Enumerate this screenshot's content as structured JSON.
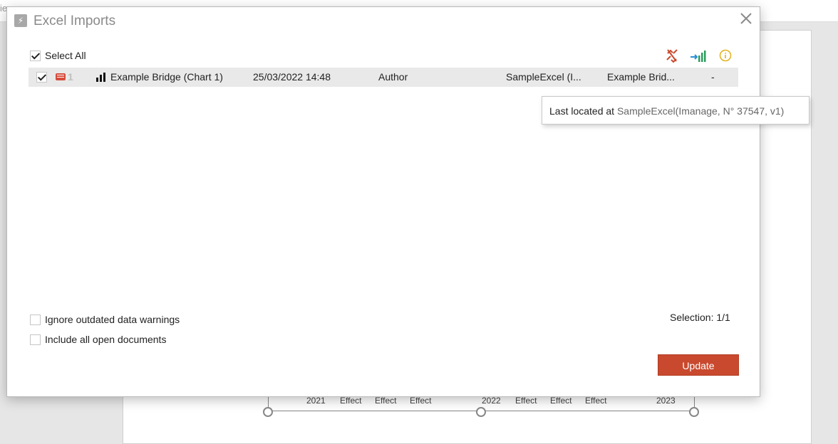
{
  "dialog": {
    "title": "Excel Imports",
    "select_all_label": "Select All",
    "select_all_checked": true,
    "toolbar_icons": [
      "broken-link-icon",
      "update-data-icon",
      "info-icon"
    ],
    "rows": [
      {
        "checked": true,
        "slide_number": "1",
        "name": "Example Bridge (Chart 1)",
        "date": "25/03/2022 14:48",
        "author": "Author",
        "source": "SampleExcel (I...",
        "sheet": "Example Brid...",
        "extra": "-"
      }
    ],
    "tooltip": {
      "prefix": "Last located at ",
      "location": "SampleExcel(Imanage, N° 37547, v1)"
    },
    "options": [
      {
        "label": "Ignore outdated data warnings",
        "checked": false
      },
      {
        "label": "Include all open documents",
        "checked": false
      }
    ],
    "selection_text": "Selection: 1/1",
    "update_label": "Update",
    "accent_color": "#c9492e"
  },
  "background": {
    "timeline_labels": [
      "2021",
      "Effect",
      "Effect",
      "Effect",
      "2022",
      "Effect",
      "Effect",
      "Effect",
      "2023"
    ]
  }
}
